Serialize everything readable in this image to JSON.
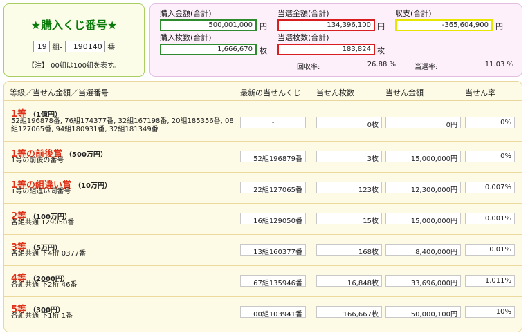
{
  "ticket": {
    "title": "★購入くじ番号★",
    "kumi": "19",
    "kumi_suffix": "組-",
    "number": "190140",
    "ban_suffix": "番",
    "note": "【注】 00組は100組を表す。"
  },
  "totals": {
    "purchase_amount_label": "購入金額(合計)",
    "purchase_amount": "500,001,000",
    "purchase_amount_unit": "円",
    "win_amount_label": "当選金額(合計)",
    "win_amount": "134,396,100",
    "win_amount_unit": "円",
    "balance_label": "収支(合計)",
    "balance": "-365,604,900",
    "balance_unit": "円",
    "purchase_count_label": "購入枚数(合計)",
    "purchase_count": "1,666,670",
    "purchase_count_unit": "枚",
    "win_count_label": "当選枚数(合計)",
    "win_count": "183,824",
    "win_count_unit": "枚",
    "recovery_rate_label": "回収率:",
    "recovery_rate": "26.88 %",
    "win_rate_label": "当選率:",
    "win_rate": "11.03 %",
    "colors": {
      "purchase": "#2e8b2e",
      "win": "#d81e1e",
      "balance": "#e6e600"
    }
  },
  "table": {
    "headers": {
      "grade": "等級／当せん金額／当選番号",
      "latest": "最新の当せんくじ",
      "count": "当せん枚数",
      "amount": "当せん金額",
      "rate": "当せん率"
    },
    "rows": [
      {
        "grade": "1等",
        "prize": "（1億円）",
        "desc1": "52組196878番, 76組174377番, 32組167198番, 20組185356番, 08",
        "desc2": "組127065番, 94組180931番, 32組181349番",
        "latest": "-",
        "count": "0枚",
        "amount": "0円",
        "rate": "0%"
      },
      {
        "grade": "1等の前後賞",
        "prize": "（500万円）",
        "desc1": "1等の前後の番号",
        "desc2": "",
        "latest": "52組196879番",
        "count": "3枚",
        "amount": "15,000,000円",
        "rate": "0%"
      },
      {
        "grade": "1等の組違い賞",
        "prize": "（10万円）",
        "desc1": "1等の組違い同番号",
        "desc2": "",
        "latest": "22組127065番",
        "count": "123枚",
        "amount": "12,300,000円",
        "rate": "0.007%"
      },
      {
        "grade": "2等",
        "prize": "（100万円）",
        "desc1": "各組共通 129050番",
        "desc2": "",
        "latest": "16組129050番",
        "count": "15枚",
        "amount": "15,000,000円",
        "rate": "0.001%"
      },
      {
        "grade": "3等",
        "prize": "（5万円）",
        "desc1": "各組共通 下4桁 0377番",
        "desc2": "",
        "latest": "13組160377番",
        "count": "168枚",
        "amount": "8,400,000円",
        "rate": "0.01%"
      },
      {
        "grade": "4等",
        "prize": "（2000円）",
        "desc1": "各組共通 下2桁 46番",
        "desc2": "",
        "latest": "67組135946番",
        "count": "16,848枚",
        "amount": "33,696,000円",
        "rate": "1.011%"
      },
      {
        "grade": "5等",
        "prize": "（300円）",
        "desc1": "各組共通 下1桁 1番",
        "desc2": "",
        "latest": "00組103941番",
        "count": "166,667枚",
        "amount": "50,000,100円",
        "rate": "10%"
      }
    ]
  }
}
